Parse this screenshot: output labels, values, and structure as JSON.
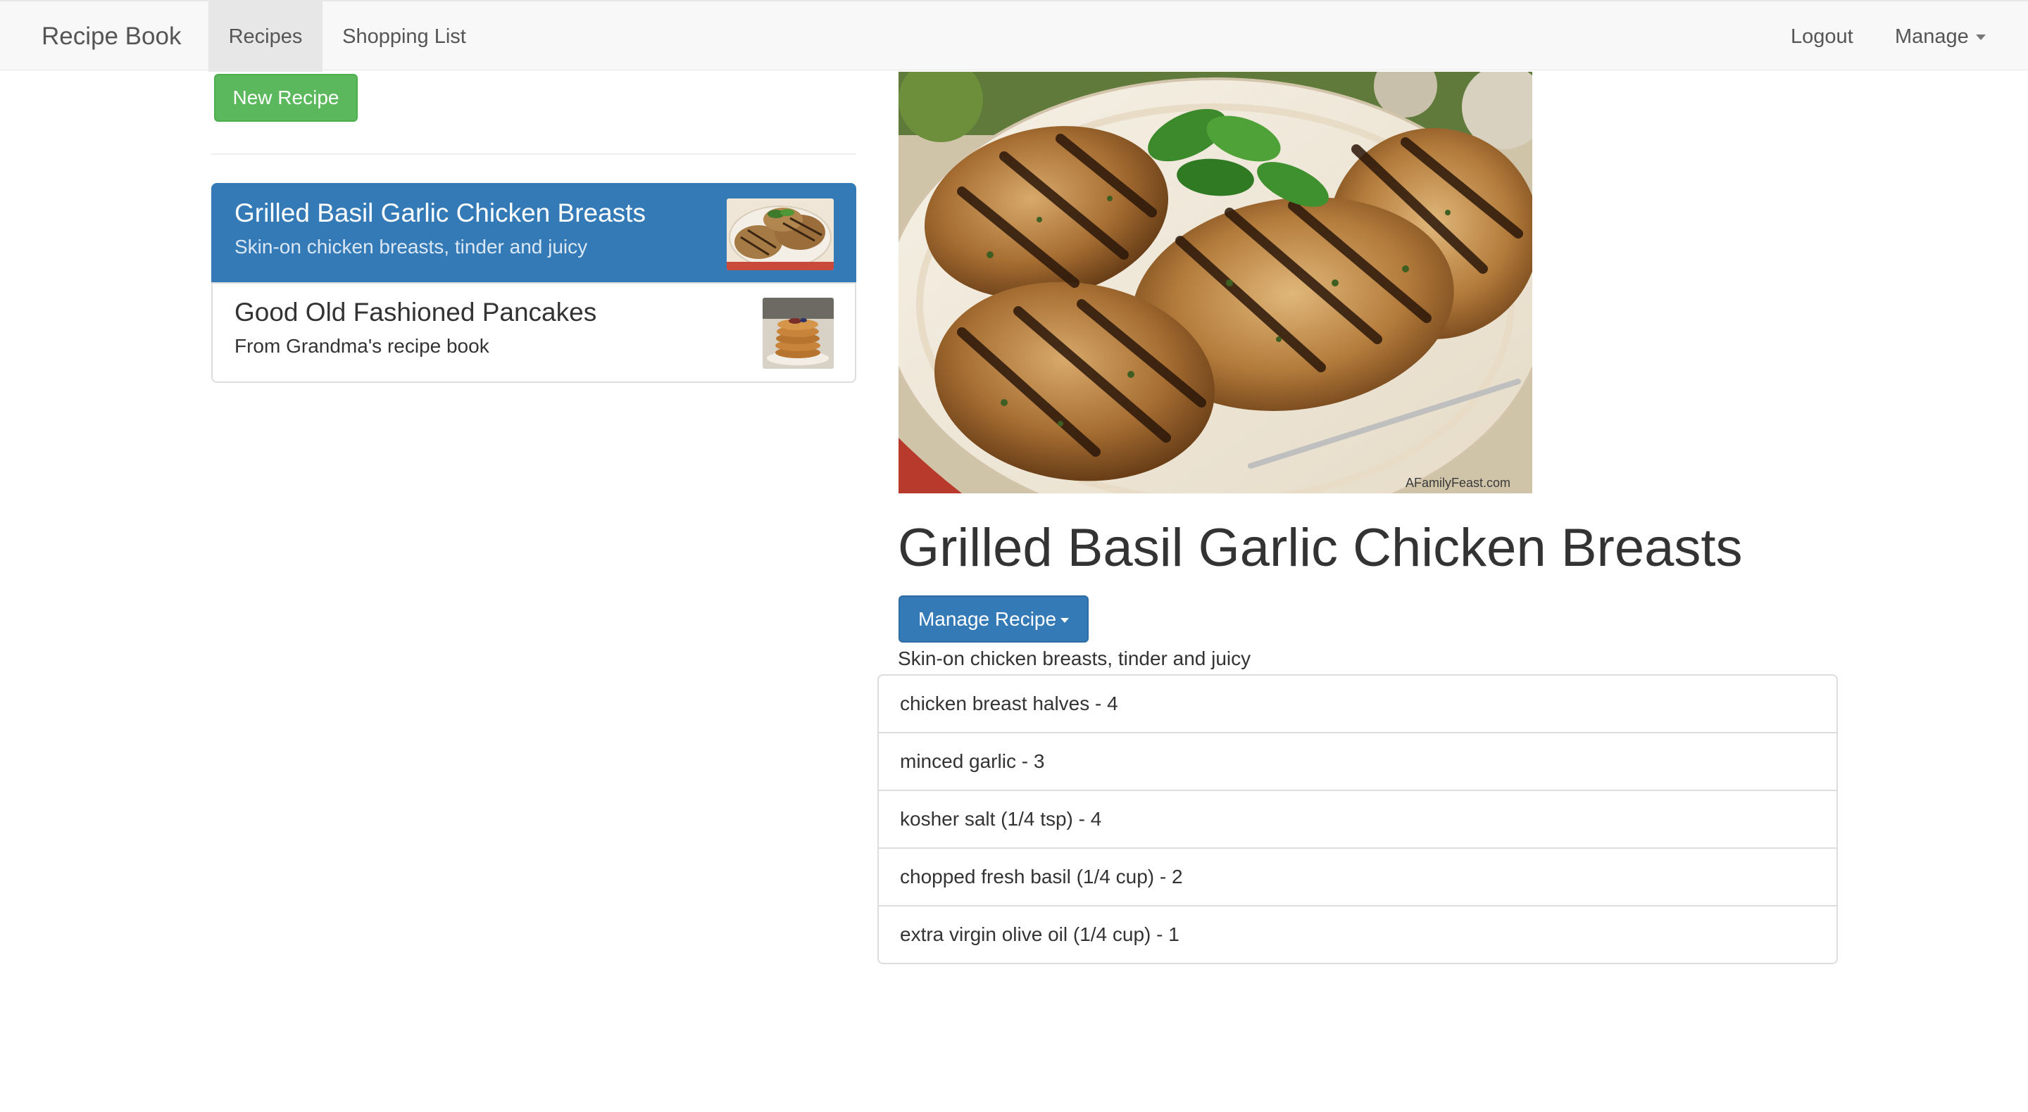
{
  "nav": {
    "brand": "Recipe Book",
    "tabs": [
      {
        "label": "Recipes",
        "active": true
      },
      {
        "label": "Shopping List",
        "active": false
      }
    ],
    "logout": "Logout",
    "manage": "Manage"
  },
  "sidebar": {
    "new_recipe_label": "New Recipe",
    "recipes": [
      {
        "name": "Grilled Basil Garlic Chicken Breasts",
        "description": "Skin-on chicken breasts, tinder and juicy",
        "active": true
      },
      {
        "name": "Good Old Fashioned Pancakes",
        "description": "From Grandma's recipe book",
        "active": false
      }
    ]
  },
  "detail": {
    "image_watermark": "AFamilyFeast.com",
    "title": "Grilled Basil Garlic Chicken Breasts",
    "manage_label": "Manage Recipe",
    "description": "Skin-on chicken breasts, tinder and juicy",
    "ingredients": [
      "chicken breast halves - 4",
      "minced garlic - 3",
      "kosher salt (1/4 tsp) - 4",
      "chopped fresh basil (1/4 cup) - 2",
      "extra virgin olive oil (1/4 cup) - 1"
    ]
  },
  "colors": {
    "navbar_bg": "#f8f8f8",
    "primary": "#337ab7",
    "success": "#5cb85c",
    "border": "#dddddd"
  },
  "icons": [
    "caret-down-icon"
  ]
}
